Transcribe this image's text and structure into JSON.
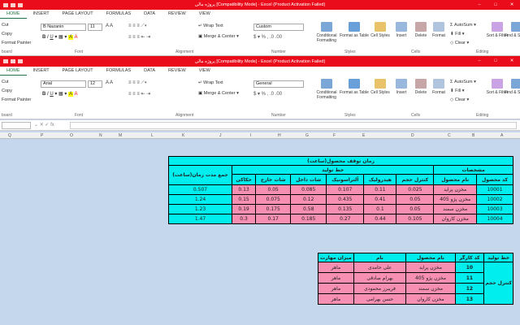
{
  "window1": {
    "title": "پروژه مالی  [Compatibility Mode] - Excel (Product Activation Failed)"
  },
  "window2": {
    "title": "پروژه مالی  [Compatibility Mode] - Excel (Product Activation Failed)"
  },
  "tabs": [
    "HOME",
    "INSERT",
    "PAGE LAYOUT",
    "FORMULAS",
    "DATA",
    "REVIEW",
    "VIEW"
  ],
  "ribbon1": {
    "clipboard": {
      "cut": "Cut",
      "copy": "Copy",
      "format_painter": "Format Painter",
      "label": "board"
    },
    "font": {
      "name": "B Nazanin",
      "size": "11",
      "label": "Font"
    },
    "alignment": {
      "wrap": "Wrap Text",
      "merge": "Merge & Center",
      "label": "Alignment"
    },
    "number": {
      "format": "Custom",
      "label": "Number"
    },
    "styles": {
      "cond": "Conditional Formatting",
      "table": "Format as Table",
      "cell": "Cell Styles",
      "label": "Styles"
    },
    "cells": {
      "insert": "Insert",
      "delete": "Delete",
      "format": "Format",
      "label": "Cells"
    },
    "editing": {
      "autosum": "AutoSum",
      "fill": "Fill",
      "clear": "Clear",
      "sort": "Sort & Filter",
      "find": "Find & Select",
      "label": "Editing"
    }
  },
  "ribbon2": {
    "clipboard": {
      "cut": "Cut",
      "copy": "Copy",
      "format_painter": "Format Painter",
      "label": "board"
    },
    "font": {
      "name": "Arial",
      "size": "12",
      "label": "Font"
    },
    "alignment": {
      "wrap": "Wrap Text",
      "merge": "Merge & Center",
      "label": "Alignment"
    },
    "number": {
      "format": "General",
      "label": "Number"
    },
    "styles": {
      "cond": "Conditional Formatting",
      "table": "Format as Table",
      "cell": "Cell Styles",
      "label": "Styles"
    },
    "cells": {
      "insert": "Insert",
      "delete": "Delete",
      "format": "Format",
      "label": "Cells"
    },
    "editing": {
      "autosum": "AutoSum",
      "fill": "Fill",
      "clear": "Clear",
      "sort": "Sort & Filter",
      "find": "Find & Select",
      "label": "Editing"
    }
  },
  "columns": [
    "Q",
    "P",
    "O",
    "N",
    "M",
    "L",
    "K",
    "J",
    "I",
    "H",
    "G",
    "F",
    "E",
    "D",
    "C",
    "B",
    "A"
  ],
  "table1": {
    "title": "زمان توقف محصول(ساعت)",
    "h_specs": "مشخصات",
    "h_line": "خط تولید",
    "h_sum": "جمع مدت زمان(ساعت)",
    "h_code": "کد محصول",
    "h_name": "نام محصول",
    "h_cols": [
      "کنترل حجم",
      "هیدرولیک",
      "آلتراسونیک",
      "شات داخل",
      "شات خارج",
      "حکاکی"
    ],
    "rows": [
      {
        "code": "10001",
        "name": "مخزن پراید",
        "v": [
          "0.025",
          "0.11",
          "0.107",
          "0.085",
          "0.05",
          "0.13"
        ],
        "sum": "0.507"
      },
      {
        "code": "10002",
        "name": "مخزن پژو 405",
        "v": [
          "0.05",
          "0.41",
          "0.435",
          "0.12",
          "0.075",
          "0.15"
        ],
        "sum": "1.24"
      },
      {
        "code": "10003",
        "name": "مخزن سمند",
        "v": [
          "0.05",
          "0.1",
          "0.135",
          "0.58",
          "0.175",
          "0.19"
        ],
        "sum": "1.23"
      },
      {
        "code": "10004",
        "name": "مخزن کاروان",
        "v": [
          "0.105",
          "0.44",
          "0.27",
          "0.185",
          "0.17",
          "0.3"
        ],
        "sum": "1.47"
      }
    ]
  },
  "table2": {
    "headers": [
      "میزان مهارت",
      "نام",
      "نام محصول",
      "کد کارگر",
      "خط تولید"
    ],
    "line": "کنترل حجم",
    "rows": [
      {
        "skill": "ماهر",
        "name": "علی حامدی",
        "product": "مخزن پراید",
        "code": "10"
      },
      {
        "skill": "ماهر",
        "name": "بهرام صادقی",
        "product": "مخزن پژو 405",
        "code": "11"
      },
      {
        "skill": "ماهر",
        "name": "فریبرز محمودی",
        "product": "مخزن سمند",
        "code": "12"
      },
      {
        "skill": "ماهر",
        "name": "حسن بهرامی",
        "product": "مخزن کاروان",
        "code": "13"
      }
    ]
  }
}
